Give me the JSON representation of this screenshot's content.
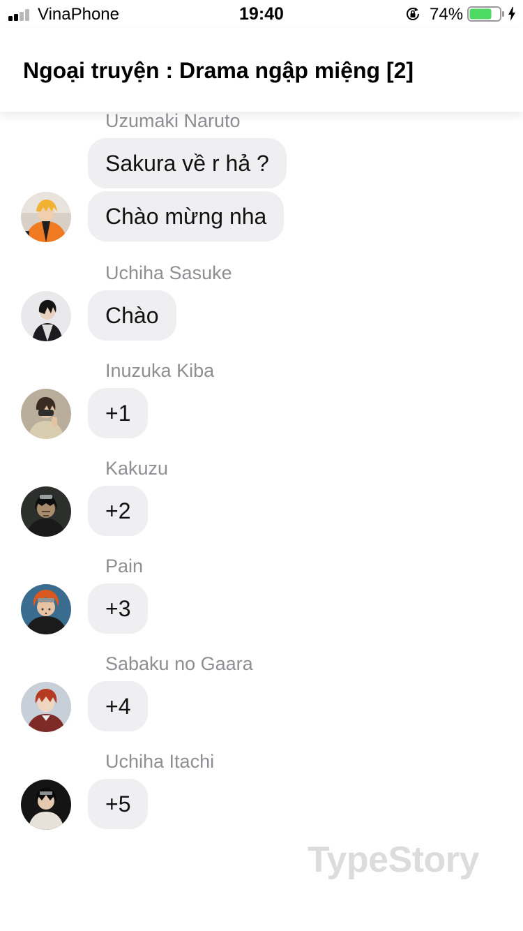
{
  "status_bar": {
    "carrier": "VinaPhone",
    "time": "19:40",
    "battery_percent": "74%",
    "battery_level": 0.74,
    "signal_bars_filled": 2,
    "colors": {
      "battery": "#4cd964"
    }
  },
  "header": {
    "title": "Ngoại truyện : Drama ngập miệng [2]"
  },
  "messages": [
    {
      "sender": "Uzumaki Naruto",
      "avatar": "naruto-avatar",
      "bubbles": [
        "Sakura về r hả ?",
        "Chào mừng nha"
      ]
    },
    {
      "sender": "Uchiha Sasuke",
      "avatar": "sasuke-avatar",
      "bubbles": [
        "Chào"
      ]
    },
    {
      "sender": "Inuzuka Kiba",
      "avatar": "kiba-avatar",
      "bubbles": [
        "+1"
      ]
    },
    {
      "sender": "Kakuzu",
      "avatar": "kakuzu-avatar",
      "bubbles": [
        "+2"
      ]
    },
    {
      "sender": "Pain",
      "avatar": "pain-avatar",
      "bubbles": [
        "+3"
      ]
    },
    {
      "sender": "Sabaku no Gaara",
      "avatar": "gaara-avatar",
      "bubbles": [
        "+4"
      ]
    },
    {
      "sender": "Uchiha Itachi",
      "avatar": "itachi-avatar",
      "bubbles": [
        "+5"
      ]
    }
  ],
  "watermark": "TypeStory",
  "colors": {
    "bubble": "#efeff2",
    "sender_name": "#8e8e93"
  }
}
